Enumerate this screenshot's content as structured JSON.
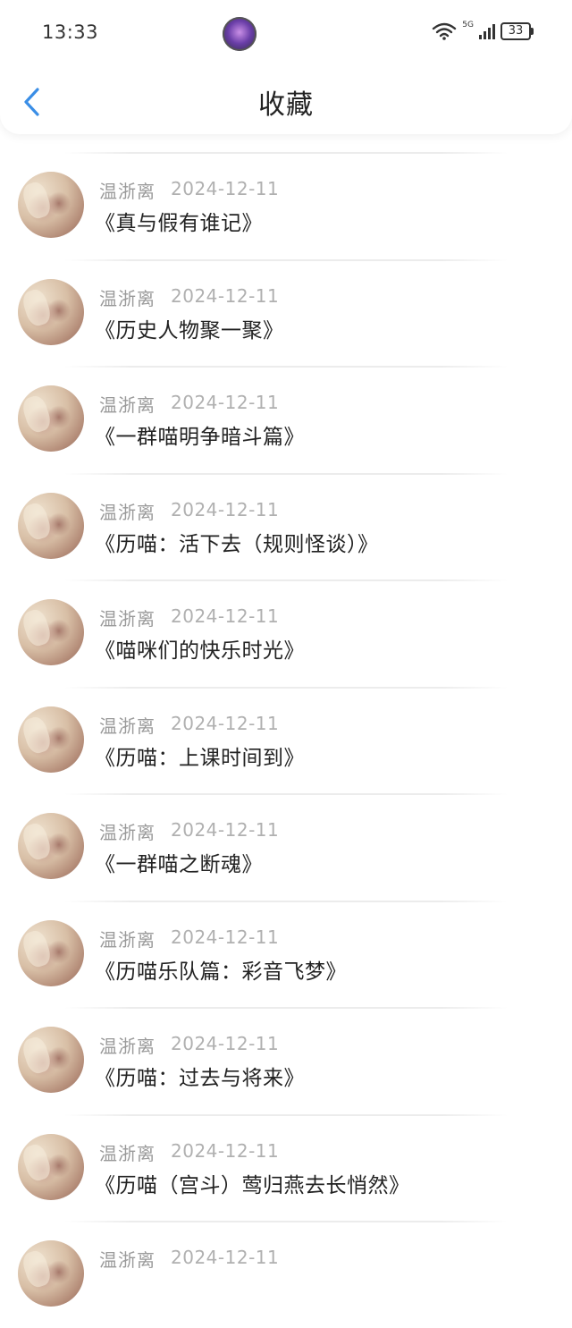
{
  "status_bar": {
    "time": "13:33",
    "network_label": "5G",
    "battery": "33"
  },
  "header": {
    "title": "收藏"
  },
  "favorites": [
    {
      "author": "温浙离",
      "date": "2024-12-11",
      "title": "《真与假有谁记》"
    },
    {
      "author": "温浙离",
      "date": "2024-12-11",
      "title": "《历史人物聚一聚》"
    },
    {
      "author": "温浙离",
      "date": "2024-12-11",
      "title": "《一群喵明争暗斗篇》"
    },
    {
      "author": "温浙离",
      "date": "2024-12-11",
      "title": "《历喵：活下去（规则怪谈）》"
    },
    {
      "author": "温浙离",
      "date": "2024-12-11",
      "title": "《喵咪们的快乐时光》"
    },
    {
      "author": "温浙离",
      "date": "2024-12-11",
      "title": "《历喵：上课时间到》"
    },
    {
      "author": "温浙离",
      "date": "2024-12-11",
      "title": "《一群喵之断魂》"
    },
    {
      "author": "温浙离",
      "date": "2024-12-11",
      "title": "《历喵乐队篇：彩音飞梦》"
    },
    {
      "author": "温浙离",
      "date": "2024-12-11",
      "title": "《历喵：过去与将来》"
    },
    {
      "author": "温浙离",
      "date": "2024-12-11",
      "title": "《历喵（宫斗）莺归燕去长悄然》"
    },
    {
      "author": "温浙离",
      "date": "2024-12-11",
      "title": ""
    }
  ],
  "colors": {
    "accent": "#3a8ee6",
    "text_primary": "#222222",
    "text_secondary": "#9a9a9a"
  }
}
